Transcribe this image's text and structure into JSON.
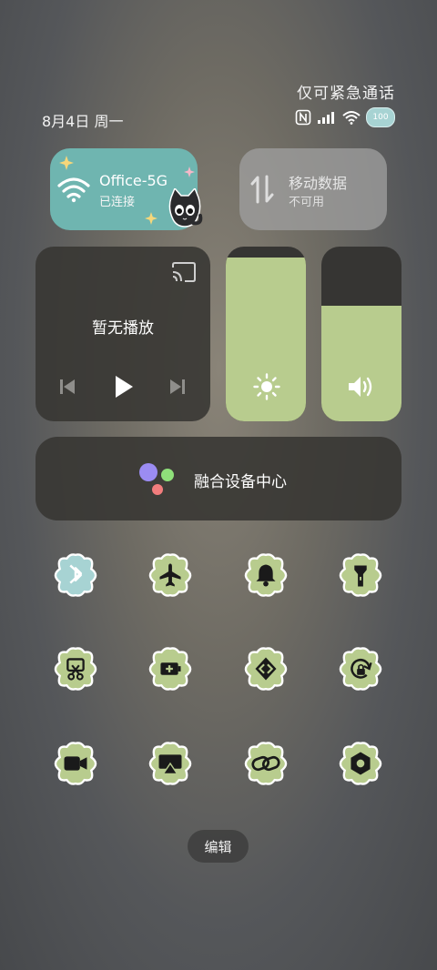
{
  "status": {
    "carrier_text": "仅可紧急通话",
    "date": "8月4日 周一",
    "battery": "100"
  },
  "wifi": {
    "ssid": "Office-5G",
    "status": "已连接",
    "color": "#6fb5b0"
  },
  "mobile_data": {
    "title": "移动数据",
    "subtitle": "不可用"
  },
  "media": {
    "title": "暂无播放"
  },
  "brightness": {
    "level_percent": 94
  },
  "volume": {
    "level_percent": 66
  },
  "device_center": {
    "label": "融合设备中心"
  },
  "toggles": [
    {
      "name": "bluetooth-icon",
      "color": "#a7d3d3"
    },
    {
      "name": "airplane-icon",
      "color": "#b8cc8e"
    },
    {
      "name": "bell-icon",
      "color": "#b8cc8e"
    },
    {
      "name": "flashlight-icon",
      "color": "#b8cc8e"
    },
    {
      "name": "screenshot-icon",
      "color": "#b8cc8e"
    },
    {
      "name": "battery-saver-icon",
      "color": "#b8cc8e"
    },
    {
      "name": "nfc-share-icon",
      "color": "#b8cc8e"
    },
    {
      "name": "rotation-lock-icon",
      "color": "#b8cc8e"
    },
    {
      "name": "screen-record-icon",
      "color": "#b8cc8e"
    },
    {
      "name": "screen-cast-icon",
      "color": "#b8cc8e"
    },
    {
      "name": "link-icon",
      "color": "#b8cc8e"
    },
    {
      "name": "settings-hex-icon",
      "color": "#b8cc8e"
    }
  ],
  "edit": {
    "label": "编辑"
  },
  "accent_green": "#b8cc8e"
}
